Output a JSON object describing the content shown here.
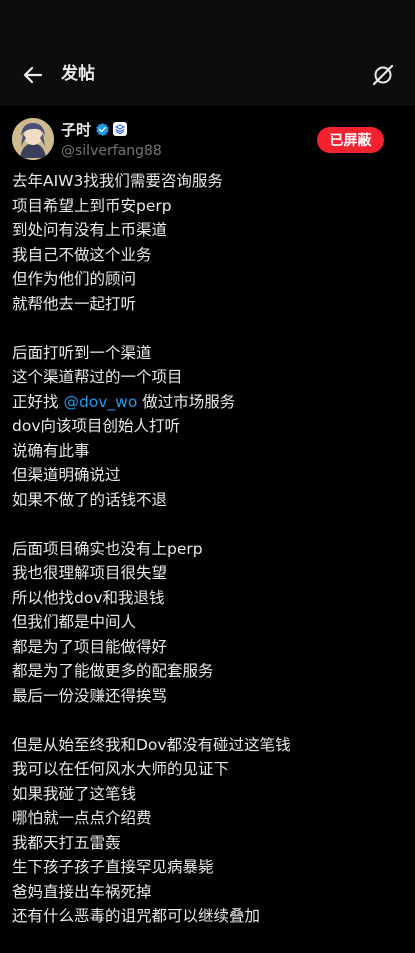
{
  "header": {
    "title": "发帖",
    "back_icon": "arrow-left-icon",
    "grok_icon": "grok-slash-icon"
  },
  "author": {
    "display_name": "子时",
    "handle": "@silverfang88",
    "verified_color": "#1d9bf0",
    "block_label": "已屏蔽",
    "block_color": "#f4212e"
  },
  "post": {
    "paragraphs": [
      {
        "lines": [
          {
            "text": "去年AIW3找我们需要咨询服务"
          },
          {
            "text": "项目希望上到币安perp"
          },
          {
            "text": "到处问有没有上币渠道"
          },
          {
            "text": "我自己不做这个业务"
          },
          {
            "text": "但作为他们的顾问"
          },
          {
            "text": "就帮他去一起打听"
          }
        ]
      },
      {
        "lines": [
          {
            "text": "后面打听到一个渠道"
          },
          {
            "text": "这个渠道帮过的一个项目"
          },
          {
            "pre": "正好找 ",
            "mention": "@dov_wo",
            "post": " 做过市场服务"
          },
          {
            "text": "dov向该项目创始人打听"
          },
          {
            "text": "说确有此事"
          },
          {
            "text": "但渠道明确说过"
          },
          {
            "text": "如果不做了的话钱不退"
          }
        ]
      },
      {
        "lines": [
          {
            "text": "后面项目确实也没有上perp"
          },
          {
            "text": "我也很理解项目很失望"
          },
          {
            "text": "所以他找dov和我退钱"
          },
          {
            "text": "但我们都是中间人"
          },
          {
            "text": "都是为了项目能做得好"
          },
          {
            "text": "都是为了能做更多的配套服务"
          },
          {
            "text": "最后一份没赚还得挨骂"
          }
        ]
      },
      {
        "lines": [
          {
            "text": "但是从始至终我和Dov都没有碰过这笔钱"
          },
          {
            "text": "我可以在任何风水大师的见证下"
          },
          {
            "text": "如果我碰了这笔钱"
          },
          {
            "text": "哪怕就一点点介绍费"
          },
          {
            "text": "我都天打五雷轰"
          },
          {
            "text": "生下孩子孩子直接罕见病暴毙"
          },
          {
            "text": "爸妈直接出车祸死掉"
          },
          {
            "text": "还有什么恶毒的诅咒都可以继续叠加"
          }
        ]
      }
    ]
  }
}
